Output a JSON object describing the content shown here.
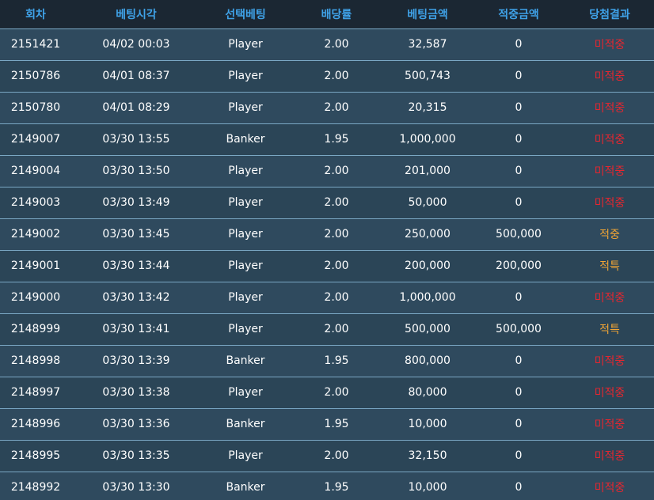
{
  "headers": [
    "회차",
    "베팅시각",
    "선택베팅",
    "배당률",
    "베팅금액",
    "적중금액",
    "당첨결과"
  ],
  "colors": {
    "header_bg": "#1b2733",
    "header_text": "#3fa2e8",
    "row_bg": "#2f4a5e",
    "row_border": "#7aa7c4",
    "result_miss": "#e6262f",
    "result_hit": "#f2a534"
  },
  "rows": [
    {
      "round": "2151421",
      "time": "04/02 00:03",
      "bet": "Player",
      "odds": "2.00",
      "amount": "32,587",
      "win": "0",
      "result": "미적중",
      "status": "miss"
    },
    {
      "round": "2150786",
      "time": "04/01 08:37",
      "bet": "Player",
      "odds": "2.00",
      "amount": "500,743",
      "win": "0",
      "result": "미적중",
      "status": "miss"
    },
    {
      "round": "2150780",
      "time": "04/01 08:29",
      "bet": "Player",
      "odds": "2.00",
      "amount": "20,315",
      "win": "0",
      "result": "미적중",
      "status": "miss"
    },
    {
      "round": "2149007",
      "time": "03/30 13:55",
      "bet": "Banker",
      "odds": "1.95",
      "amount": "1,000,000",
      "win": "0",
      "result": "미적중",
      "status": "miss"
    },
    {
      "round": "2149004",
      "time": "03/30 13:50",
      "bet": "Player",
      "odds": "2.00",
      "amount": "201,000",
      "win": "0",
      "result": "미적중",
      "status": "miss"
    },
    {
      "round": "2149003",
      "time": "03/30 13:49",
      "bet": "Player",
      "odds": "2.00",
      "amount": "50,000",
      "win": "0",
      "result": "미적중",
      "status": "miss"
    },
    {
      "round": "2149002",
      "time": "03/30 13:45",
      "bet": "Player",
      "odds": "2.00",
      "amount": "250,000",
      "win": "500,000",
      "result": "적중",
      "status": "hit"
    },
    {
      "round": "2149001",
      "time": "03/30 13:44",
      "bet": "Player",
      "odds": "2.00",
      "amount": "200,000",
      "win": "200,000",
      "result": "적특",
      "status": "hit"
    },
    {
      "round": "2149000",
      "time": "03/30 13:42",
      "bet": "Player",
      "odds": "2.00",
      "amount": "1,000,000",
      "win": "0",
      "result": "미적중",
      "status": "miss"
    },
    {
      "round": "2148999",
      "time": "03/30 13:41",
      "bet": "Player",
      "odds": "2.00",
      "amount": "500,000",
      "win": "500,000",
      "result": "적특",
      "status": "hit"
    },
    {
      "round": "2148998",
      "time": "03/30 13:39",
      "bet": "Banker",
      "odds": "1.95",
      "amount": "800,000",
      "win": "0",
      "result": "미적중",
      "status": "miss"
    },
    {
      "round": "2148997",
      "time": "03/30 13:38",
      "bet": "Player",
      "odds": "2.00",
      "amount": "80,000",
      "win": "0",
      "result": "미적중",
      "status": "miss"
    },
    {
      "round": "2148996",
      "time": "03/30 13:36",
      "bet": "Banker",
      "odds": "1.95",
      "amount": "10,000",
      "win": "0",
      "result": "미적중",
      "status": "miss"
    },
    {
      "round": "2148995",
      "time": "03/30 13:35",
      "bet": "Player",
      "odds": "2.00",
      "amount": "32,150",
      "win": "0",
      "result": "미적중",
      "status": "miss"
    },
    {
      "round": "2148992",
      "time": "03/30 13:30",
      "bet": "Banker",
      "odds": "1.95",
      "amount": "10,000",
      "win": "0",
      "result": "미적중",
      "status": "miss"
    }
  ]
}
